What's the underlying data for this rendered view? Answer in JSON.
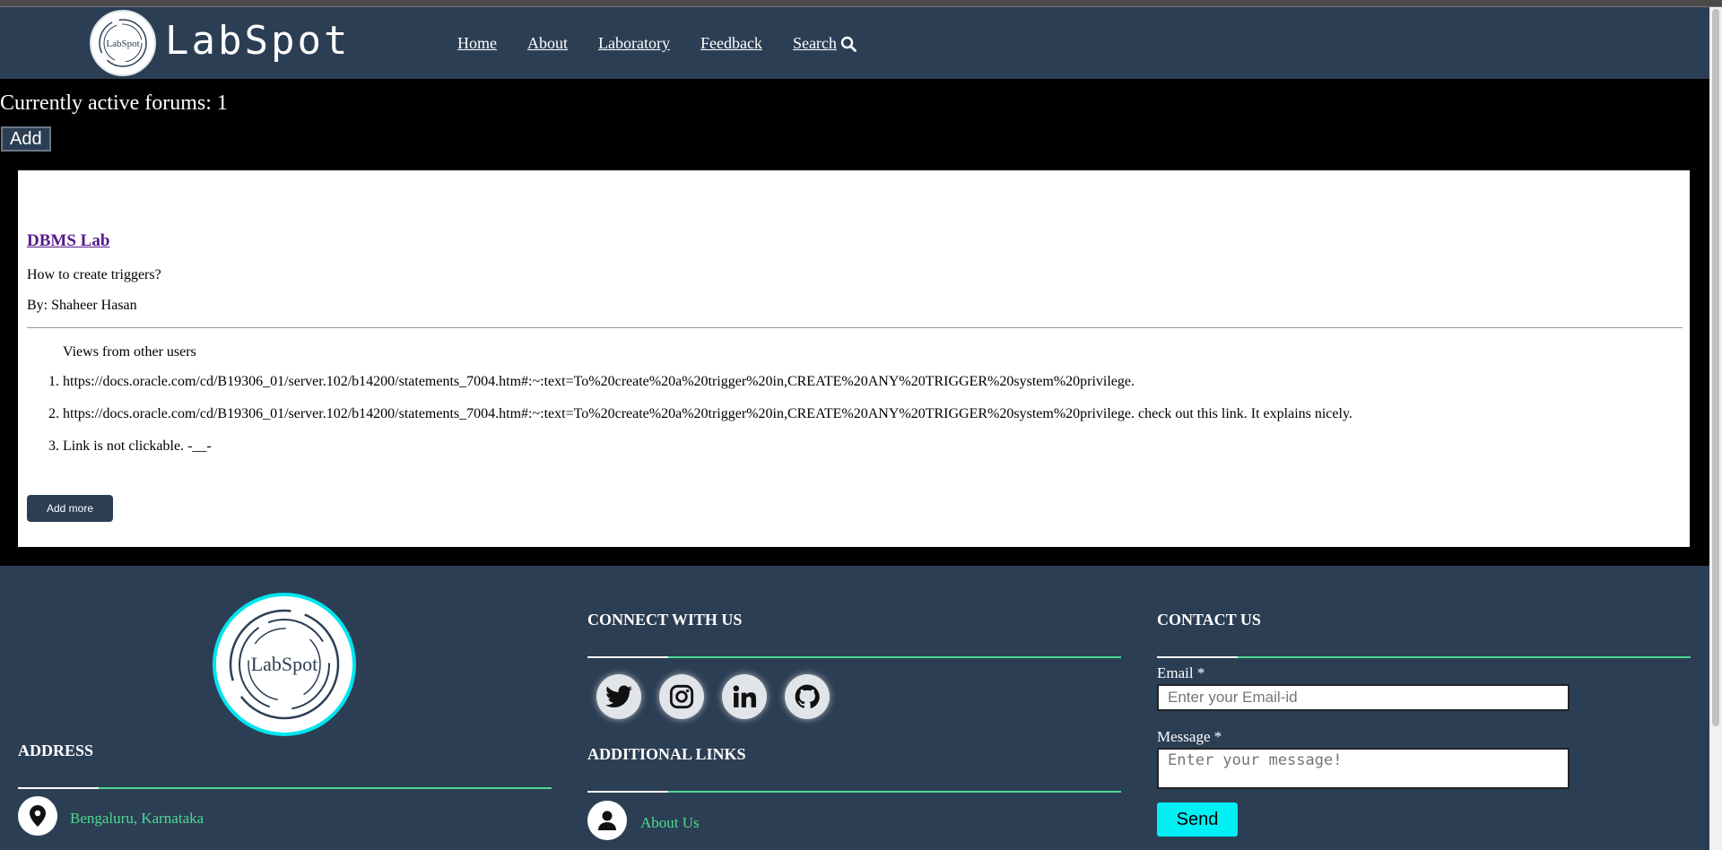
{
  "header": {
    "brand": "LabSpot",
    "logo_text": "LabSpot",
    "nav": [
      "Home",
      "About",
      "Laboratory",
      "Feedback",
      "Search"
    ]
  },
  "forums": {
    "count_text": "Currently active forums: 1",
    "add_label": "Add"
  },
  "card": {
    "title": "DBMS Lab",
    "question": "How to create triggers?",
    "author_prefix": "By:",
    "author": "Shaheer Hasan",
    "views_title": "Views from other users",
    "views": [
      "https://docs.oracle.com/cd/B19306_01/server.102/b14200/statements_7004.htm#:~:text=To%20create%20a%20trigger%20in,CREATE%20ANY%20TRIGGER%20system%20privilege.",
      "https://docs.oracle.com/cd/B19306_01/server.102/b14200/statements_7004.htm#:~:text=To%20create%20a%20trigger%20in,CREATE%20ANY%20TRIGGER%20system%20privilege. check out this link. It explains nicely.",
      "Link is not clickable. -__-"
    ],
    "add_more_label": "Add more"
  },
  "footer": {
    "logo_text": "LabSpot",
    "address_title": "ADDRESS",
    "address": "Bengaluru, Karnataka",
    "connect_title": "CONNECT WITH US",
    "social": [
      "twitter-icon",
      "instagram-icon",
      "linkedin-icon",
      "github-icon"
    ],
    "links_title": "ADDITIONAL LINKS",
    "about_link": "About Us",
    "contact_title": "CONTACT US",
    "email_label": "Email *",
    "email_placeholder": "Enter your Email-id",
    "message_label": "Message *",
    "message_placeholder": "Enter your message!",
    "send_label": "Send"
  },
  "colors": {
    "header_bg": "#2c3e54",
    "accent_green": "#4cd990",
    "cyan": "#00f0f5",
    "link_purple": "#551a8b"
  }
}
